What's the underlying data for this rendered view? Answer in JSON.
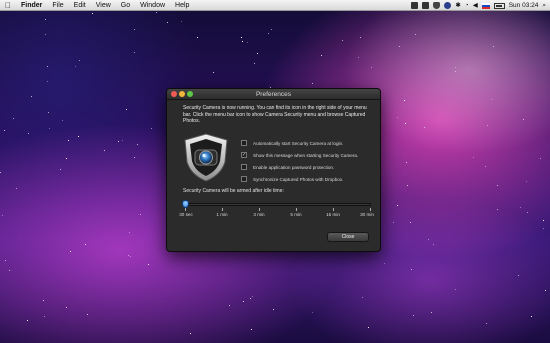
{
  "menubar": {
    "apple_icon": "apple-icon",
    "app_name": "Finder",
    "items": [
      "File",
      "Edit",
      "View",
      "Go",
      "Window",
      "Help"
    ],
    "clock": "Sun 03:24",
    "status_icons": [
      "app-icon",
      "app-icon",
      "security-camera-icon",
      "timemachine-icon",
      "bluetooth-icon",
      "wifi-icon",
      "volume-icon",
      "flag-icon",
      "battery-icon",
      "spotlight-icon"
    ]
  },
  "window": {
    "title": "Preferences",
    "intro": "Security Camera is now running. You can find its icon in the right side of your menu bar. Click the menu bar icon to show Camera Security menu and browse Captured Photos.",
    "options": [
      {
        "label": "Automatically start Security Camera at login.",
        "checked": false
      },
      {
        "label": "Show this message when starting Security Camera.",
        "checked": true
      },
      {
        "label": "Enable application password protection.",
        "checked": false
      },
      {
        "label": "Synchronize Captured Photos with Dropbox.",
        "checked": false
      }
    ],
    "idle_label": "Security Camera will be armed after idle time:",
    "slider": {
      "ticks": [
        "30 sec",
        "1 min",
        "3 min",
        "5 min",
        "15 min",
        "30 min"
      ],
      "selected_index": 0
    },
    "close_label": "Close"
  },
  "colors": {
    "window_bg": "#2b2b2b",
    "slider_knob": "#2f7fd6",
    "close_red": "#ee5b54",
    "minimize_yellow": "#f3b73b",
    "zoom_green": "#5ec745"
  }
}
